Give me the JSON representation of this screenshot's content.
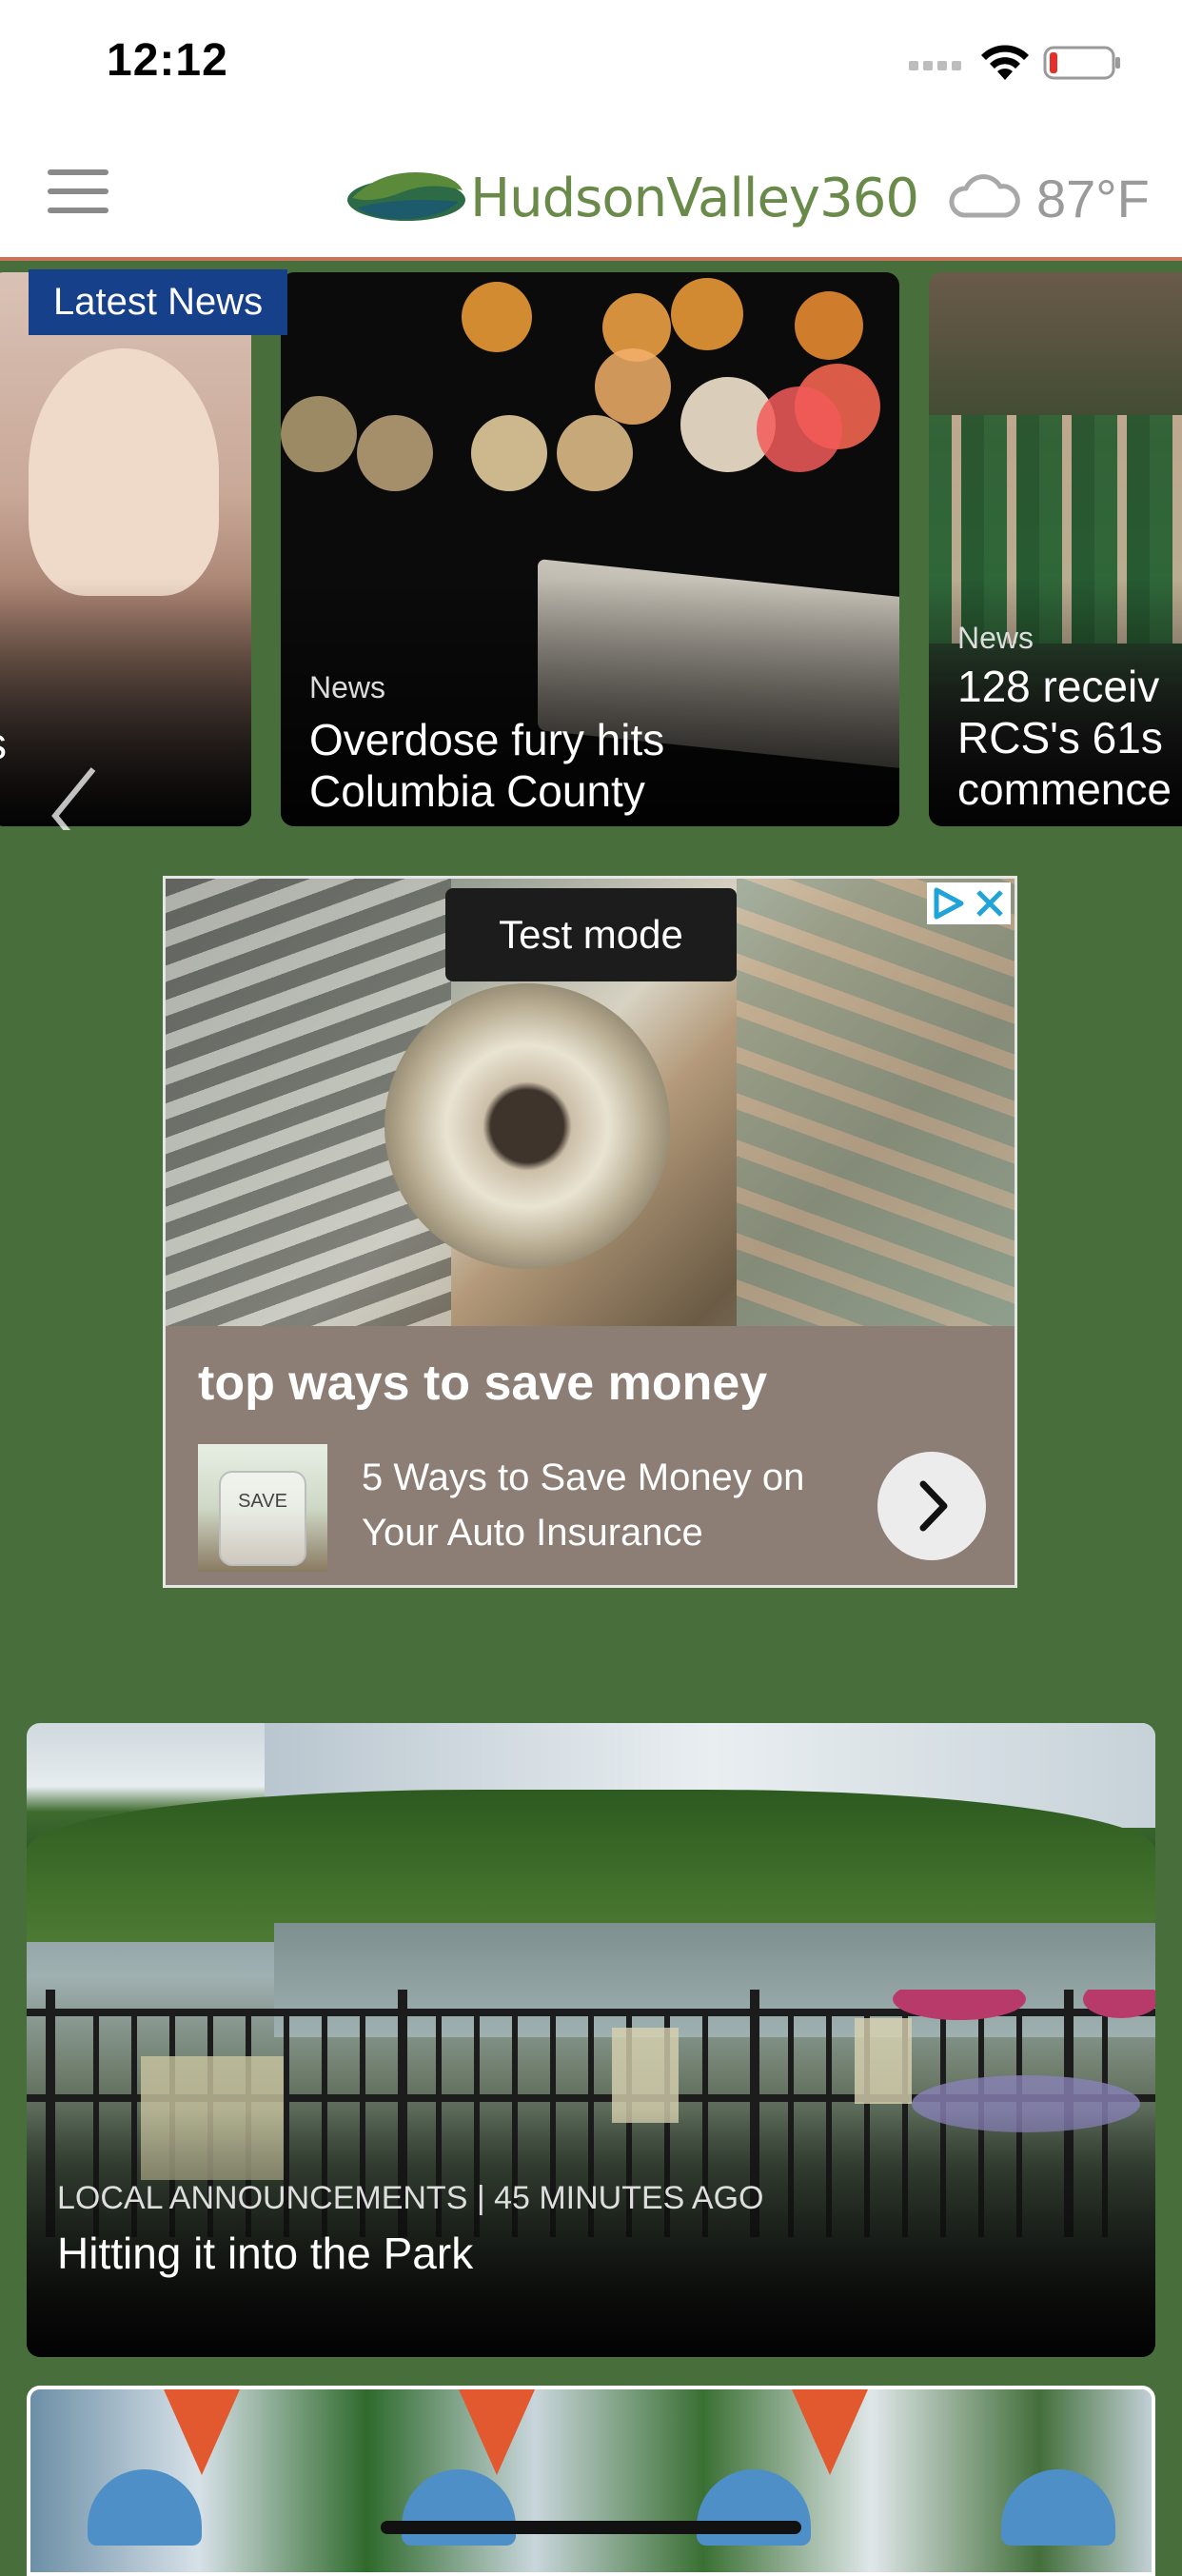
{
  "status_bar": {
    "time": "12:12",
    "icons": [
      "cellular-signal-icon",
      "wifi-icon",
      "battery-low-icon"
    ]
  },
  "header": {
    "menu_icon": "hamburger-menu-icon",
    "logo_text": "HudsonValley360",
    "weather_icon": "cloud-icon",
    "temperature": "87°F",
    "accent_color": "#c9735d"
  },
  "carousel": {
    "badge": "Latest News",
    "badge_color": "#17408b",
    "prev_icon": "chevron-left-icon",
    "cards": [
      {
        "category": "",
        "title": "s"
      },
      {
        "category": "News",
        "title_lines": [
          "Overdose fury hits",
          "Columbia County"
        ]
      },
      {
        "category": "News",
        "title_lines": [
          "128 receiv",
          "RCS's 61s",
          "commence"
        ]
      }
    ]
  },
  "ad": {
    "test_mode": "Test mode",
    "choices_icons": [
      "adchoices-icon",
      "close-icon"
    ],
    "headline": "top ways to save money",
    "thumb_label": "SAVE",
    "description_lines": [
      "5 Ways to Save Money on",
      "Your Auto Insurance"
    ],
    "cta_icon": "chevron-right-icon"
  },
  "story": {
    "meta": "LOCAL ANNOUNCEMENTS | 45 MINUTES AGO",
    "title": "Hitting it into the Park"
  },
  "background_color": "#476e3b"
}
